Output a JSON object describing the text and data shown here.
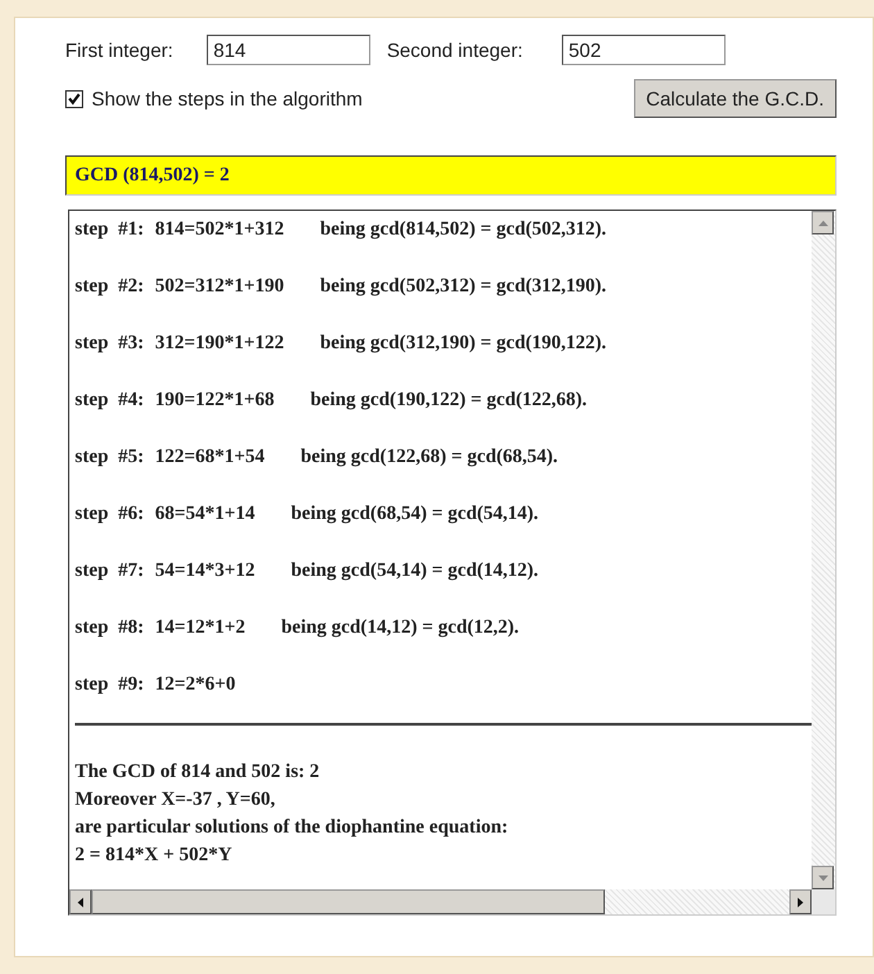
{
  "form": {
    "first_label": "First integer:",
    "first_value": "814",
    "second_label": "Second integer:",
    "second_value": "502",
    "show_steps": {
      "label": "Show the steps in the algorithm",
      "checked": true
    },
    "button": "Calculate the G.C.D."
  },
  "result": "GCD (814,502) = 2",
  "steps": [
    {
      "label": "step  #1:",
      "equation": "814=502*1+312",
      "note": "being gcd(814,502) = gcd(502,312)."
    },
    {
      "label": "step  #2:",
      "equation": "502=312*1+190",
      "note": "being gcd(502,312) = gcd(312,190)."
    },
    {
      "label": "step  #3:",
      "equation": "312=190*1+122",
      "note": "being gcd(312,190) = gcd(190,122)."
    },
    {
      "label": "step  #4:",
      "equation": "190=122*1+68",
      "note": "being gcd(190,122) = gcd(122,68)."
    },
    {
      "label": "step  #5:",
      "equation": "122=68*1+54",
      "note": "being gcd(122,68) = gcd(68,54)."
    },
    {
      "label": "step  #6:",
      "equation": "68=54*1+14",
      "note": "being gcd(68,54) = gcd(54,14)."
    },
    {
      "label": "step  #7:",
      "equation": "54=14*3+12",
      "note": "being gcd(54,14) = gcd(14,12)."
    },
    {
      "label": "step  #8:",
      "equation": "14=12*1+2",
      "note": "being gcd(14,12) = gcd(12,2)."
    },
    {
      "label": "step  #9:",
      "equation": "12=2*6+0"
    }
  ],
  "summary": [
    "The GCD of 814 and 502 is: 2",
    "Moreover X=-37 , Y=60,",
    "are particular solutions of the diophantine equation:",
    "2 = 814*X + 502*Y"
  ]
}
